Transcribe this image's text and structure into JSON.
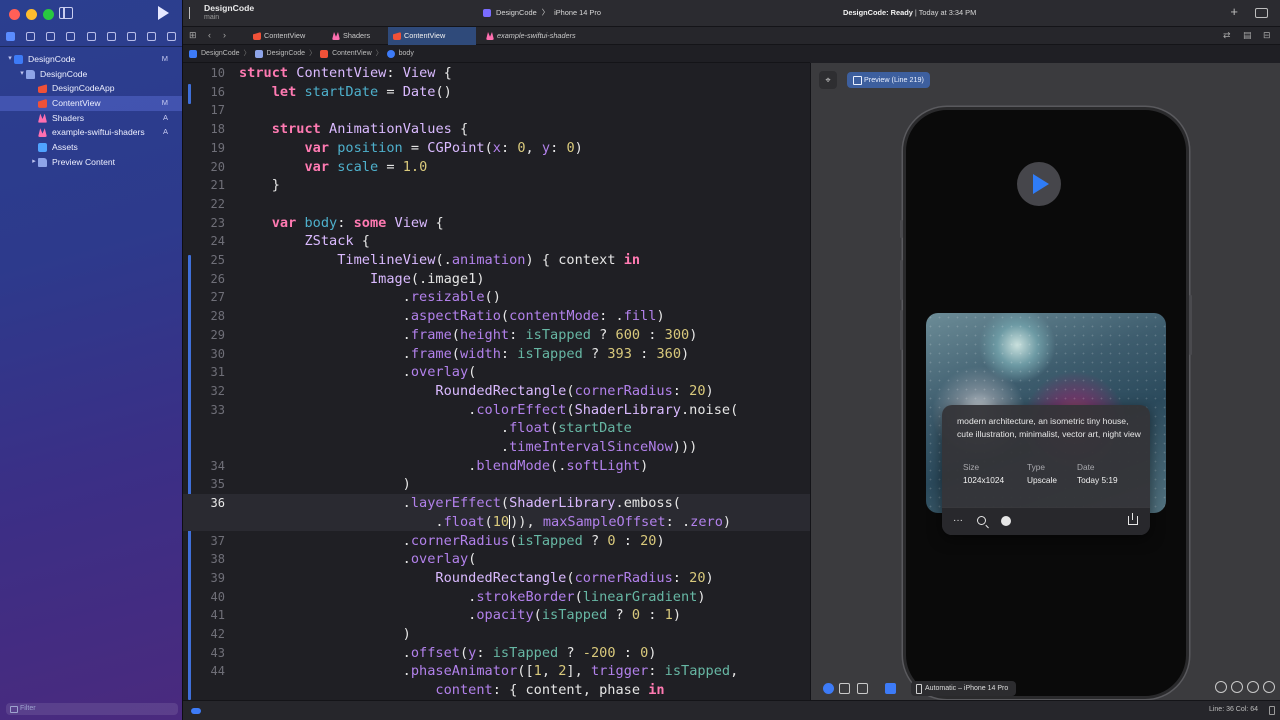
{
  "sidebar": {
    "tree": [
      {
        "label": "DesignCode",
        "badge": "M",
        "icon": "project-icon",
        "level": 0,
        "expanded": true,
        "selected": false
      },
      {
        "label": "DesignCode",
        "badge": "",
        "icon": "folder-icon",
        "level": 1,
        "expanded": true,
        "selected": false
      },
      {
        "label": "DesignCodeApp",
        "badge": "",
        "icon": "swift-file-icon",
        "level": 2,
        "selected": false
      },
      {
        "label": "ContentView",
        "badge": "M",
        "icon": "swift-file-icon",
        "level": 2,
        "selected": true
      },
      {
        "label": "Shaders",
        "badge": "A",
        "icon": "metal-file-icon",
        "level": 2,
        "selected": false
      },
      {
        "label": "example-swiftui-shaders",
        "badge": "A",
        "icon": "metal-file-icon",
        "level": 2,
        "selected": false
      },
      {
        "label": "Assets",
        "badge": "",
        "icon": "assets-icon",
        "level": 2,
        "selected": false
      },
      {
        "label": "Preview Content",
        "badge": "",
        "icon": "folder-icon",
        "level": 2,
        "collapsed": true,
        "selected": false
      }
    ],
    "filter_placeholder": "Filter"
  },
  "titlebar": {
    "project": "DesignCode",
    "branch": "main",
    "scheme": "DesignCode",
    "device": "iPhone 14 Pro",
    "status_bold": "DesignCode: Ready",
    "status_rest": " | Today at 3:34 PM"
  },
  "tabs": [
    {
      "label": "ContentView",
      "icon": "swift-file-icon",
      "active": false,
      "italic": false
    },
    {
      "label": "Shaders",
      "icon": "metal-file-icon",
      "active": false,
      "italic": false
    },
    {
      "label": "ContentView",
      "icon": "swift-file-icon",
      "active": true,
      "italic": false
    },
    {
      "label": "example-swiftui-shaders",
      "icon": "metal-file-icon",
      "active": false,
      "italic": true
    }
  ],
  "breadcrumb": [
    "DesignCode",
    "DesignCode",
    "ContentView",
    "body"
  ],
  "editor": {
    "current_line": 36,
    "lines": [
      {
        "n": "10",
        "t": [
          [
            "k",
            "struct "
          ],
          [
            "ty",
            "ContentView"
          ],
          [
            "pl",
            ": "
          ],
          [
            "ty",
            "View"
          ],
          [
            "pl",
            " {"
          ]
        ]
      },
      {
        "n": "16",
        "t": [
          [
            "pl",
            "    "
          ],
          [
            "k",
            "let "
          ],
          [
            "df",
            "startDate"
          ],
          [
            "pl",
            " = "
          ],
          [
            "ty",
            "Date"
          ],
          [
            "pl",
            "()"
          ]
        ]
      },
      {
        "n": "17",
        "t": []
      },
      {
        "n": "18",
        "t": [
          [
            "pl",
            "    "
          ],
          [
            "k",
            "struct "
          ],
          [
            "ty",
            "AnimationValues"
          ],
          [
            "pl",
            " {"
          ]
        ]
      },
      {
        "n": "19",
        "t": [
          [
            "pl",
            "        "
          ],
          [
            "k",
            "var "
          ],
          [
            "df",
            "position"
          ],
          [
            "pl",
            " = "
          ],
          [
            "ty",
            "CGPoint"
          ],
          [
            "pl",
            "("
          ],
          [
            "fn",
            "x"
          ],
          [
            "pl",
            ": "
          ],
          [
            "nm",
            "0"
          ],
          [
            "pl",
            ", "
          ],
          [
            "fn",
            "y"
          ],
          [
            "pl",
            ": "
          ],
          [
            "nm",
            "0"
          ],
          [
            "pl",
            ")"
          ]
        ]
      },
      {
        "n": "20",
        "t": [
          [
            "pl",
            "        "
          ],
          [
            "k",
            "var "
          ],
          [
            "df",
            "scale"
          ],
          [
            "pl",
            " = "
          ],
          [
            "nm",
            "1.0"
          ]
        ]
      },
      {
        "n": "21",
        "t": [
          [
            "pl",
            "    }"
          ]
        ]
      },
      {
        "n": "22",
        "t": []
      },
      {
        "n": "23",
        "t": [
          [
            "pl",
            "    "
          ],
          [
            "k",
            "var "
          ],
          [
            "df",
            "body"
          ],
          [
            "pl",
            ": "
          ],
          [
            "k",
            "some "
          ],
          [
            "ty",
            "View"
          ],
          [
            "pl",
            " {"
          ]
        ]
      },
      {
        "n": "24",
        "t": [
          [
            "pl",
            "        "
          ],
          [
            "ty",
            "ZStack"
          ],
          [
            "pl",
            " {"
          ]
        ]
      },
      {
        "n": "25",
        "t": [
          [
            "pl",
            "            "
          ],
          [
            "ty",
            "TimelineView"
          ],
          [
            "pl",
            "(."
          ],
          [
            "fn",
            "animation"
          ],
          [
            "pl",
            ") { context "
          ],
          [
            "k",
            "in"
          ]
        ]
      },
      {
        "n": "26",
        "t": [
          [
            "pl",
            "                "
          ],
          [
            "ty",
            "Image"
          ],
          [
            "pl",
            "(."
          ],
          [
            "pl",
            "image1"
          ],
          [
            "pl",
            ")"
          ]
        ]
      },
      {
        "n": "27",
        "t": [
          [
            "pl",
            "                    ."
          ],
          [
            "fn",
            "resizable"
          ],
          [
            "pl",
            "()"
          ]
        ]
      },
      {
        "n": "28",
        "t": [
          [
            "pl",
            "                    ."
          ],
          [
            "fn",
            "aspectRatio"
          ],
          [
            "pl",
            "("
          ],
          [
            "fn",
            "contentMode"
          ],
          [
            "pl",
            ": ."
          ],
          [
            "fn",
            "fill"
          ],
          [
            "pl",
            ")"
          ]
        ]
      },
      {
        "n": "29",
        "t": [
          [
            "pl",
            "                    ."
          ],
          [
            "fn",
            "frame"
          ],
          [
            "pl",
            "("
          ],
          [
            "fn",
            "height"
          ],
          [
            "pl",
            ": "
          ],
          [
            "pr",
            "isTapped"
          ],
          [
            "pl",
            " ? "
          ],
          [
            "nm",
            "600"
          ],
          [
            "pl",
            " : "
          ],
          [
            "nm",
            "300"
          ],
          [
            "pl",
            ")"
          ]
        ]
      },
      {
        "n": "30",
        "t": [
          [
            "pl",
            "                    ."
          ],
          [
            "fn",
            "frame"
          ],
          [
            "pl",
            "("
          ],
          [
            "fn",
            "width"
          ],
          [
            "pl",
            ": "
          ],
          [
            "pr",
            "isTapped"
          ],
          [
            "pl",
            " ? "
          ],
          [
            "nm",
            "393"
          ],
          [
            "pl",
            " : "
          ],
          [
            "nm",
            "360"
          ],
          [
            "pl",
            ")"
          ]
        ]
      },
      {
        "n": "31",
        "t": [
          [
            "pl",
            "                    ."
          ],
          [
            "fn",
            "overlay"
          ],
          [
            "pl",
            "("
          ]
        ]
      },
      {
        "n": "32",
        "t": [
          [
            "pl",
            "                        "
          ],
          [
            "ty",
            "RoundedRectangle"
          ],
          [
            "pl",
            "("
          ],
          [
            "fn",
            "cornerRadius"
          ],
          [
            "pl",
            ": "
          ],
          [
            "nm",
            "20"
          ],
          [
            "pl",
            ")"
          ]
        ]
      },
      {
        "n": "33",
        "t": [
          [
            "pl",
            "                            ."
          ],
          [
            "fn",
            "colorEffect"
          ],
          [
            "pl",
            "("
          ],
          [
            "ty",
            "ShaderLibrary"
          ],
          [
            "pl",
            "."
          ],
          [
            "pl",
            "noise"
          ],
          [
            "pl",
            "("
          ]
        ]
      },
      {
        "n": "",
        "t": [
          [
            "pl",
            "                                ."
          ],
          [
            "fn",
            "float"
          ],
          [
            "pl",
            "("
          ],
          [
            "pr",
            "startDate"
          ]
        ]
      },
      {
        "n": "",
        "t": [
          [
            "pl",
            "                                ."
          ],
          [
            "fn",
            "timeIntervalSinceNow"
          ],
          [
            "pl",
            ")))"
          ]
        ]
      },
      {
        "n": "34",
        "t": [
          [
            "pl",
            "                            ."
          ],
          [
            "fn",
            "blendMode"
          ],
          [
            "pl",
            "(."
          ],
          [
            "fn",
            "softLight"
          ],
          [
            "pl",
            ")"
          ]
        ]
      },
      {
        "n": "35",
        "t": [
          [
            "pl",
            "                    )"
          ]
        ]
      },
      {
        "n": "36",
        "t": [
          [
            "pl",
            "                    ."
          ],
          [
            "fn",
            "layerEffect"
          ],
          [
            "pl",
            "("
          ],
          [
            "ty",
            "ShaderLibrary"
          ],
          [
            "pl",
            "."
          ],
          [
            "pl",
            "emboss"
          ],
          [
            "pl",
            "("
          ]
        ]
      },
      {
        "n": "",
        "t": [
          [
            "pl",
            "                        ."
          ],
          [
            "fn",
            "float"
          ],
          [
            "pl",
            "("
          ],
          [
            "nm",
            "10"
          ],
          [
            "cur",
            ""
          ],
          [
            "pl",
            "))"
          ],
          [
            "pl",
            ", "
          ],
          [
            "fn",
            "maxSampleOffset"
          ],
          [
            "pl",
            ": ."
          ],
          [
            "fn",
            "zero"
          ],
          [
            "pl",
            ")"
          ]
        ]
      },
      {
        "n": "37",
        "t": [
          [
            "pl",
            "                    ."
          ],
          [
            "fn",
            "cornerRadius"
          ],
          [
            "pl",
            "("
          ],
          [
            "pr",
            "isTapped"
          ],
          [
            "pl",
            " ? "
          ],
          [
            "nm",
            "0"
          ],
          [
            "pl",
            " : "
          ],
          [
            "nm",
            "20"
          ],
          [
            "pl",
            ")"
          ]
        ]
      },
      {
        "n": "38",
        "t": [
          [
            "pl",
            "                    ."
          ],
          [
            "fn",
            "overlay"
          ],
          [
            "pl",
            "("
          ]
        ]
      },
      {
        "n": "39",
        "t": [
          [
            "pl",
            "                        "
          ],
          [
            "ty",
            "RoundedRectangle"
          ],
          [
            "pl",
            "("
          ],
          [
            "fn",
            "cornerRadius"
          ],
          [
            "pl",
            ": "
          ],
          [
            "nm",
            "20"
          ],
          [
            "pl",
            ")"
          ]
        ]
      },
      {
        "n": "40",
        "t": [
          [
            "pl",
            "                            ."
          ],
          [
            "fn",
            "strokeBorder"
          ],
          [
            "pl",
            "("
          ],
          [
            "pr",
            "linearGradient"
          ],
          [
            "pl",
            ")"
          ]
        ]
      },
      {
        "n": "41",
        "t": [
          [
            "pl",
            "                            ."
          ],
          [
            "fn",
            "opacity"
          ],
          [
            "pl",
            "("
          ],
          [
            "pr",
            "isTapped"
          ],
          [
            "pl",
            " ? "
          ],
          [
            "nm",
            "0"
          ],
          [
            "pl",
            " : "
          ],
          [
            "nm",
            "1"
          ],
          [
            "pl",
            ")"
          ]
        ]
      },
      {
        "n": "42",
        "t": [
          [
            "pl",
            "                    )"
          ]
        ]
      },
      {
        "n": "43",
        "t": [
          [
            "pl",
            "                    ."
          ],
          [
            "fn",
            "offset"
          ],
          [
            "pl",
            "("
          ],
          [
            "fn",
            "y"
          ],
          [
            "pl",
            ": "
          ],
          [
            "pr",
            "isTapped"
          ],
          [
            "pl",
            " ? "
          ],
          [
            "nm",
            "-200"
          ],
          [
            "pl",
            " : "
          ],
          [
            "nm",
            "0"
          ],
          [
            "pl",
            ")"
          ]
        ]
      },
      {
        "n": "44",
        "t": [
          [
            "pl",
            "                    ."
          ],
          [
            "fn",
            "phaseAnimator"
          ],
          [
            "pl",
            "(["
          ],
          [
            "nm",
            "1"
          ],
          [
            "pl",
            ", "
          ],
          [
            "nm",
            "2"
          ],
          [
            "pl",
            "], "
          ],
          [
            "fn",
            "trigger"
          ],
          [
            "pl",
            ": "
          ],
          [
            "pr",
            "isTapped"
          ],
          [
            "pl",
            ","
          ]
        ]
      },
      {
        "n": "",
        "t": [
          [
            "pl",
            "                        "
          ],
          [
            "fn",
            "content"
          ],
          [
            "pl",
            ": { content, phase "
          ],
          [
            "k",
            "in"
          ]
        ]
      }
    ]
  },
  "canvas": {
    "preview_label": "Preview (Line 219)",
    "device_selector": "Automatic – iPhone 14 Pro",
    "card": {
      "description": "modern architecture, an isometric tiny house, cute illustration, minimalist, vector art, night view",
      "size_label": "Size",
      "size_value": "1024x1024",
      "type_label": "Type",
      "type_value": "Upscale",
      "date_label": "Date",
      "date_value": "Today 5:19"
    }
  },
  "statusbar": {
    "position": "Line: 36  Col: 64"
  },
  "colors": {
    "keyword": "#ff7ab2",
    "type": "#dabaff",
    "function": "#b281eb",
    "number": "#d9c97c",
    "accent": "#3d7bf7"
  }
}
